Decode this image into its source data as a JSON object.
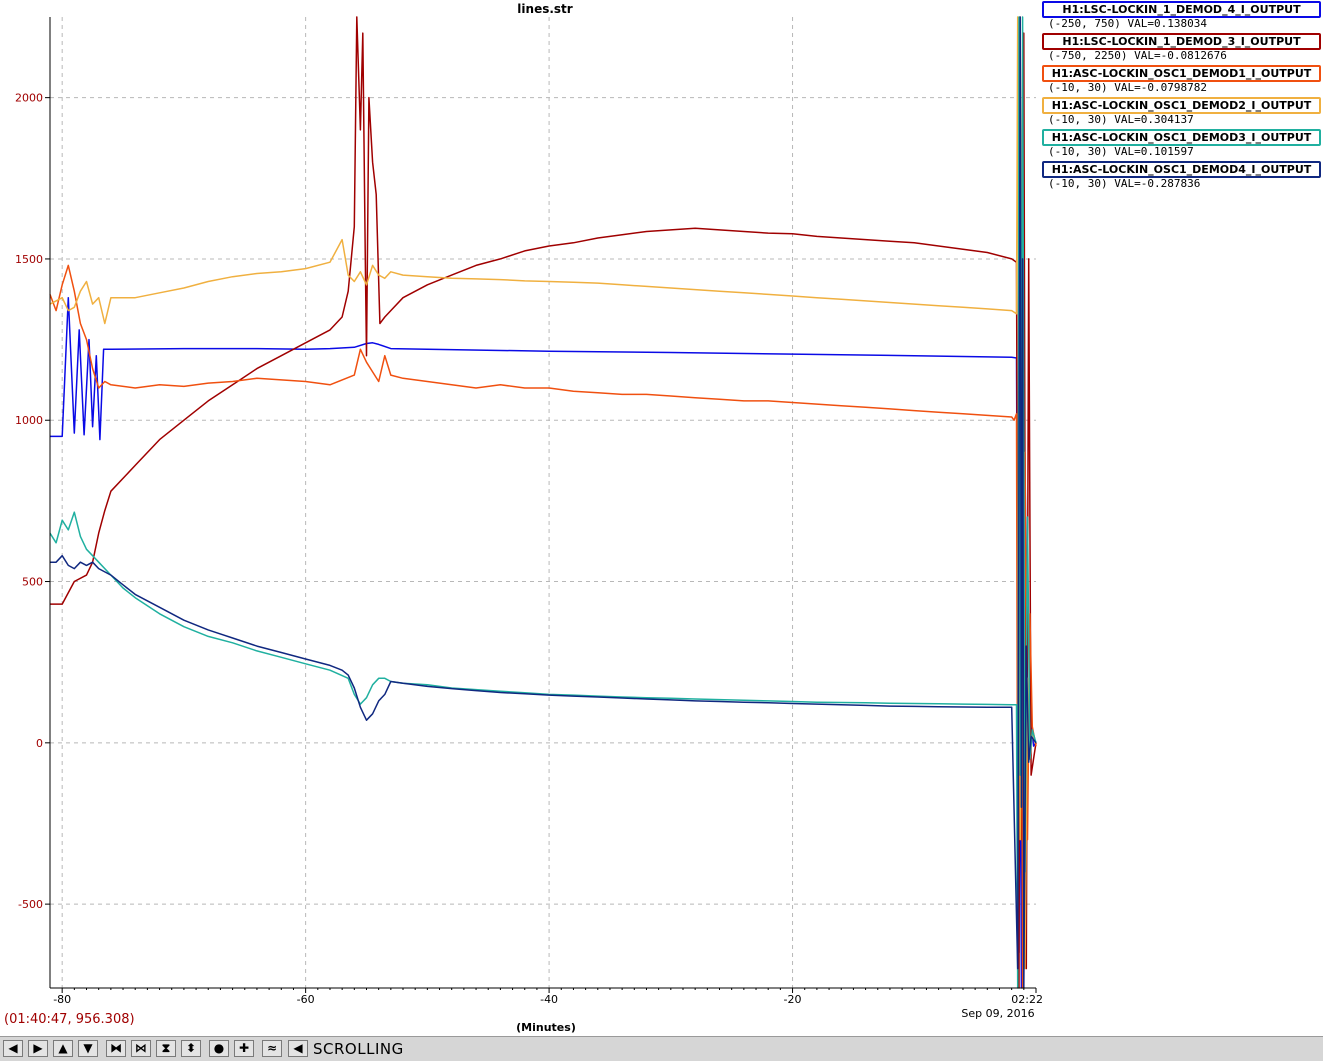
{
  "chart_data": {
    "type": "line",
    "title": "lines.str",
    "xlabel": "(Minutes)",
    "xlim": [
      -81,
      0
    ],
    "ylim": [
      -760,
      2250
    ],
    "y_ticks": [
      -500,
      0,
      500,
      1000,
      1500,
      2000
    ],
    "x_ticks": [
      {
        "value": -80,
        "label": "-80"
      },
      {
        "value": -60,
        "label": "-60"
      },
      {
        "value": -40,
        "label": "-40"
      },
      {
        "value": -20,
        "label": "-20"
      },
      {
        "value": 0,
        "label": "02:22:44"
      }
    ],
    "end_date": "Sep 09, 2016",
    "grid": true,
    "legend_position": "right",
    "series": [
      {
        "name": "H1:LSC-LOCKIN_1_DEMOD_4_I_OUTPUT",
        "range": "(-250, 750)",
        "val": "VAL=0.138034",
        "color": "#0a0ae6",
        "x": [
          -81,
          -80,
          -79.5,
          -79,
          -78.6,
          -78.2,
          -77.8,
          -77.5,
          -77.2,
          -76.9,
          -76.6,
          -76,
          -70,
          -64,
          -60,
          -58,
          -56,
          -55,
          -54.5,
          -54,
          -53,
          -50,
          -40,
          -30,
          -20,
          -10,
          -2,
          -1.6,
          -1.4,
          -1.3,
          -1.2,
          -1.1,
          -1,
          -0.9,
          -0.7,
          -0.5,
          -0.2,
          0
        ],
        "y": [
          950,
          950,
          1380,
          960,
          1280,
          955,
          1250,
          980,
          1200,
          940,
          1220,
          1220,
          1222,
          1222,
          1220,
          1222,
          1226,
          1238,
          1240,
          1235,
          1222,
          1220,
          1214,
          1210,
          1205,
          1200,
          1195,
          1193,
          -650,
          200,
          -800,
          1400,
          -200,
          900,
          -100,
          100,
          -10,
          0
        ]
      },
      {
        "name": "H1:LSC-LOCKIN_1_DEMOD_3_I_OUTPUT",
        "range": "(-750, 2250)",
        "val": "VAL=-0.0812676",
        "color": "#a00000",
        "x": [
          -81,
          -80,
          -79,
          -78,
          -77.5,
          -77,
          -76.5,
          -76,
          -74,
          -72,
          -70,
          -68,
          -66,
          -64,
          -62,
          -60,
          -58,
          -57,
          -56.5,
          -56,
          -55.8,
          -55.5,
          -55.3,
          -55.1,
          -55,
          -54.8,
          -54.5,
          -54.2,
          -53.9,
          -53.5,
          -53,
          -52,
          -50,
          -48,
          -46,
          -44,
          -42,
          -40,
          -38,
          -36,
          -34,
          -32,
          -30,
          -28,
          -26,
          -24,
          -22,
          -20,
          -18,
          -16,
          -14,
          -12,
          -10,
          -8,
          -6,
          -4,
          -2,
          -1.6,
          -1.4,
          -1.3,
          -1.2,
          -1,
          -0.8,
          -0.6,
          -0.4,
          0
        ],
        "y": [
          430,
          430,
          500,
          520,
          560,
          650,
          720,
          780,
          860,
          940,
          1000,
          1060,
          1110,
          1160,
          1200,
          1240,
          1280,
          1320,
          1400,
          1600,
          2250,
          1900,
          2200,
          1500,
          1200,
          2000,
          1800,
          1700,
          1300,
          1320,
          1340,
          1380,
          1420,
          1450,
          1480,
          1500,
          1525,
          1540,
          1550,
          1565,
          1575,
          1585,
          1590,
          1595,
          1590,
          1585,
          1580,
          1578,
          1570,
          1565,
          1560,
          1555,
          1550,
          1540,
          1530,
          1520,
          1500,
          1490,
          -800,
          2100,
          -300,
          2200,
          -700,
          1500,
          -100,
          0
        ]
      },
      {
        "name": "H1:ASC-LOCKIN_OSC1_DEMOD1_I_OUTPUT",
        "range": "(-10, 30)",
        "val": "VAL=-0.0798782",
        "color": "#f05010",
        "x": [
          -81,
          -80.5,
          -80,
          -79.5,
          -79,
          -78.5,
          -78,
          -77.5,
          -77,
          -76.5,
          -76,
          -74,
          -72,
          -70,
          -68,
          -66,
          -64,
          -62,
          -60,
          -58,
          -56,
          -55.5,
          -55,
          -54.5,
          -54,
          -53.5,
          -53,
          -52,
          -50,
          -48,
          -46,
          -44,
          -42,
          -40,
          -38,
          -36,
          -34,
          -32,
          -30,
          -28,
          -26,
          -24,
          -22,
          -20,
          -18,
          -16,
          -14,
          -12,
          -10,
          -8,
          -6,
          -4,
          -2,
          -1.8,
          -1.6,
          -1.5,
          -1.3,
          -1.1,
          -0.9,
          -0.7,
          -0.5,
          -0.3,
          0
        ],
        "y": [
          1390,
          1340,
          1420,
          1480,
          1400,
          1300,
          1250,
          1160,
          1100,
          1120,
          1110,
          1100,
          1110,
          1105,
          1115,
          1120,
          1130,
          1125,
          1120,
          1110,
          1140,
          1220,
          1180,
          1150,
          1120,
          1200,
          1140,
          1130,
          1120,
          1110,
          1100,
          1110,
          1100,
          1100,
          1090,
          1085,
          1080,
          1080,
          1075,
          1070,
          1065,
          1060,
          1060,
          1055,
          1050,
          1045,
          1040,
          1035,
          1030,
          1025,
          1020,
          1015,
          1010,
          1000,
          1020,
          -400,
          2250,
          -800,
          900,
          -300,
          400,
          50,
          -10
        ]
      },
      {
        "name": "H1:ASC-LOCKIN_OSC1_DEMOD2_I_OUTPUT",
        "range": "(-10, 30)",
        "val": "VAL=0.304137",
        "color": "#f0b040",
        "x": [
          -81,
          -80.5,
          -80,
          -79.5,
          -79,
          -78.5,
          -78,
          -77.5,
          -77,
          -76.5,
          -76,
          -74,
          -72,
          -70,
          -68,
          -66,
          -64,
          -62,
          -60,
          -58,
          -57,
          -56.5,
          -56,
          -55.5,
          -55,
          -54.5,
          -54,
          -53.5,
          -53,
          -52,
          -50,
          -48,
          -46,
          -44,
          -42,
          -40,
          -38,
          -36,
          -34,
          -32,
          -30,
          -28,
          -26,
          -24,
          -22,
          -20,
          -18,
          -16,
          -14,
          -12,
          -10,
          -8,
          -6,
          -4,
          -2,
          -1.6,
          -1.5,
          -1.3,
          -1.1,
          -0.9,
          -0.7,
          -0.5,
          -0.3,
          0
        ],
        "y": [
          1360,
          1370,
          1380,
          1340,
          1350,
          1400,
          1430,
          1360,
          1380,
          1300,
          1380,
          1380,
          1395,
          1410,
          1430,
          1445,
          1455,
          1460,
          1470,
          1490,
          1560,
          1450,
          1430,
          1460,
          1420,
          1480,
          1450,
          1440,
          1460,
          1450,
          1445,
          1440,
          1438,
          1436,
          1432,
          1430,
          1428,
          1425,
          1420,
          1415,
          1410,
          1405,
          1400,
          1395,
          1390,
          1385,
          1380,
          1375,
          1370,
          1365,
          1360,
          1355,
          1350,
          1345,
          1340,
          1330,
          2250,
          -300,
          1300,
          -700,
          200,
          -50,
          30,
          0
        ]
      },
      {
        "name": "H1:ASC-LOCKIN_OSC1_DEMOD3_I_OUTPUT",
        "range": "(-10, 30)",
        "val": "VAL=0.101597",
        "color": "#20b0a0",
        "x": [
          -81,
          -80.5,
          -80,
          -79.5,
          -79,
          -78.5,
          -78,
          -77.5,
          -77,
          -76,
          -75,
          -74,
          -72,
          -70,
          -68,
          -66,
          -64,
          -62,
          -60,
          -58,
          -56.5,
          -56,
          -55.5,
          -55,
          -54.5,
          -54,
          -53.5,
          -53,
          -52,
          -50,
          -48,
          -46,
          -44,
          -42,
          -40,
          -38,
          -36,
          -34,
          -32,
          -30,
          -28,
          -26,
          -24,
          -22,
          -20,
          -18,
          -16,
          -14,
          -12,
          -10,
          -8,
          -6,
          -4,
          -2,
          -1.6,
          -1.5,
          -1.4,
          -1.3,
          -1.1,
          -0.9,
          -0.7,
          -0.5,
          -0.3,
          0
        ],
        "y": [
          650,
          620,
          690,
          660,
          715,
          640,
          600,
          580,
          560,
          520,
          480,
          450,
          400,
          360,
          330,
          310,
          285,
          265,
          245,
          225,
          200,
          150,
          120,
          140,
          180,
          200,
          200,
          190,
          185,
          180,
          170,
          165,
          160,
          155,
          150,
          148,
          145,
          142,
          140,
          138,
          136,
          134,
          132,
          130,
          128,
          126,
          125,
          124,
          123,
          122,
          121,
          120,
          119,
          118,
          118,
          -760,
          2250,
          -100,
          2250,
          -400,
          700,
          -50,
          40,
          0
        ]
      },
      {
        "name": "H1:ASC-LOCKIN_OSC1_DEMOD4_I_OUTPUT",
        "range": "(-10, 30)",
        "val": "VAL=-0.287836",
        "color": "#102880",
        "x": [
          -81,
          -80.5,
          -80,
          -79.5,
          -79,
          -78.5,
          -78,
          -77.5,
          -77,
          -76,
          -75,
          -74,
          -72,
          -70,
          -68,
          -66,
          -64,
          -62,
          -60,
          -58,
          -57,
          -56.5,
          -56,
          -55.5,
          -55,
          -54.5,
          -54,
          -53.5,
          -53,
          -52,
          -50,
          -48,
          -46,
          -44,
          -42,
          -40,
          -38,
          -36,
          -34,
          -32,
          -30,
          -28,
          -26,
          -24,
          -22,
          -20,
          -18,
          -16,
          -14,
          -12,
          -10,
          -8,
          -6,
          -4,
          -2,
          -1.5,
          -1.3,
          -1.2,
          -1.1,
          -1,
          -0.8,
          -0.6,
          -0.4,
          0
        ],
        "y": [
          560,
          560,
          580,
          550,
          540,
          560,
          550,
          560,
          540,
          520,
          490,
          460,
          420,
          380,
          350,
          325,
          300,
          280,
          260,
          240,
          225,
          210,
          170,
          110,
          70,
          90,
          130,
          150,
          190,
          185,
          175,
          168,
          162,
          156,
          152,
          148,
          145,
          142,
          139,
          136,
          133,
          130,
          128,
          126,
          124,
          122,
          120,
          118,
          116,
          114,
          113,
          112,
          111,
          110,
          110,
          -700,
          2250,
          -200,
          1500,
          -760,
          300,
          -60,
          20,
          0
        ]
      }
    ]
  },
  "cursor_readout": "(01:40:47, 956.308)",
  "toolbar": {
    "status": "SCROLLING",
    "buttons": [
      {
        "name": "scroll-left-button",
        "glyph": "◀"
      },
      {
        "name": "scroll-right-button",
        "glyph": "▶"
      },
      {
        "name": "scroll-up-button",
        "glyph": "▲"
      },
      {
        "name": "scroll-down-button",
        "glyph": "▼"
      },
      {
        "name": "zoom-x-out-button",
        "glyph": "⧓"
      },
      {
        "name": "zoom-x-in-button",
        "glyph": "⋈"
      },
      {
        "name": "zoom-y-out-button",
        "glyph": "⧗"
      },
      {
        "name": "zoom-y-in-button",
        "glyph": "⬍"
      },
      {
        "name": "reset-button",
        "glyph": "●"
      },
      {
        "name": "add-button",
        "glyph": "✚"
      },
      {
        "name": "mode-button",
        "glyph": "≈"
      },
      {
        "name": "back-button",
        "glyph": "◀"
      }
    ]
  }
}
